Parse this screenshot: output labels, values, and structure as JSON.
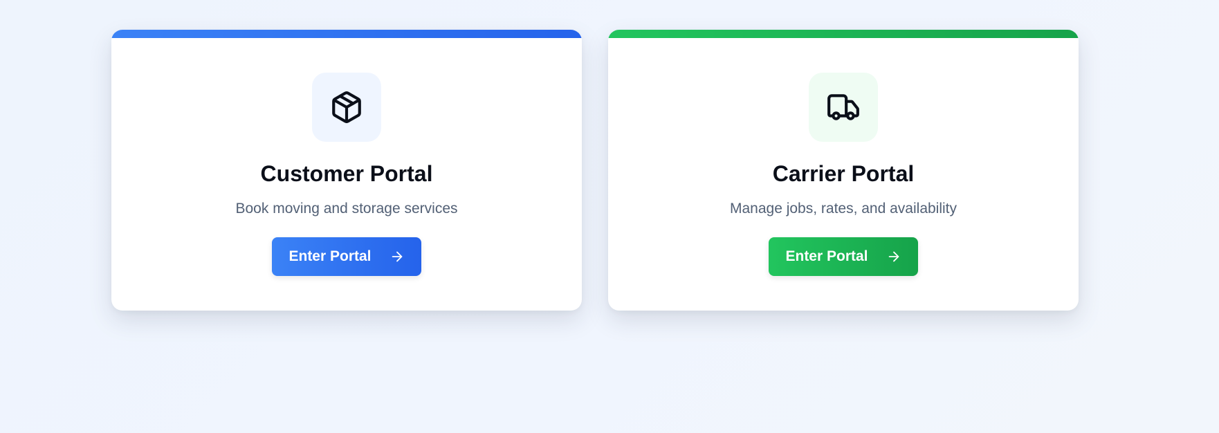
{
  "cards": [
    {
      "id": "customer",
      "icon": "package-icon",
      "title": "Customer Portal",
      "description": "Book moving and storage services",
      "button_label": "Enter Portal",
      "accent_color": "#3b82f6"
    },
    {
      "id": "carrier",
      "icon": "truck-icon",
      "title": "Carrier Portal",
      "description": "Manage jobs, rates, and availability",
      "button_label": "Enter Portal",
      "accent_color": "#22c55e"
    }
  ],
  "button_icon": "arrow-right-icon"
}
